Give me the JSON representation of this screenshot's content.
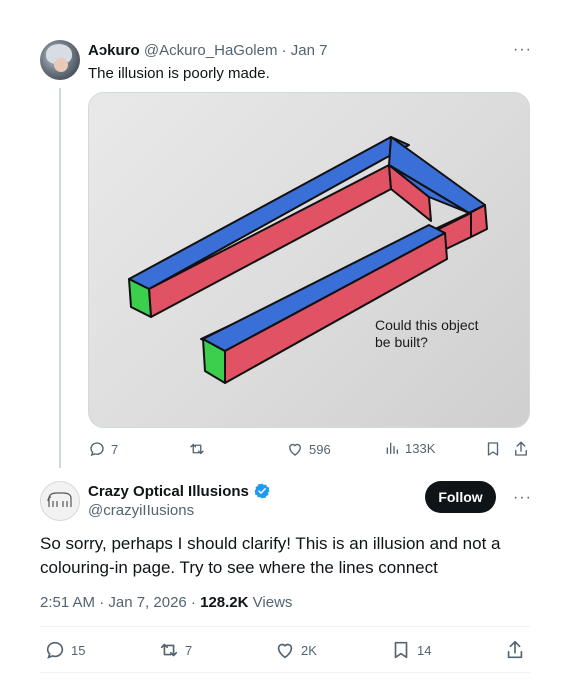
{
  "parent_tweet": {
    "display_name": "Aɔkuro",
    "handle": "@Ackuro_HaGolem",
    "date": "· Jan 7",
    "text": "The illusion is poorly made.",
    "image_caption_line1": "Could this object",
    "image_caption_line2": "be built?",
    "stats": {
      "replies": "7",
      "retweets": "",
      "likes": "596",
      "views": "133K"
    }
  },
  "focused_tweet": {
    "display_name": "Crazy Optical Illusions",
    "handle": "@crazyiIIusions",
    "follow_label": "Follow",
    "text": "So sorry, perhaps I should clarify! This is an illusion and not a colouring-in page. Try to see where the lines connect",
    "timestamp": "2:51 AM · Jan 7, 2026 ·",
    "views_count": "128.2K",
    "views_label": "Views",
    "stats": {
      "replies": "15",
      "retweets": "7",
      "likes": "2K",
      "bookmarks": "14"
    }
  },
  "colors": {
    "text_primary": "#0f1419",
    "text_secondary": "#536471",
    "verified_blue": "#1d9bf0",
    "follow_bg": "#0f1419",
    "illusion_blue": "#3a6fd8",
    "illusion_red": "#e05264",
    "illusion_green": "#3ccf4e"
  },
  "icons": [
    "more-icon",
    "reply-icon",
    "retweet-icon",
    "like-icon",
    "views-icon",
    "bookmark-icon",
    "share-icon",
    "verified-badge-icon"
  ]
}
